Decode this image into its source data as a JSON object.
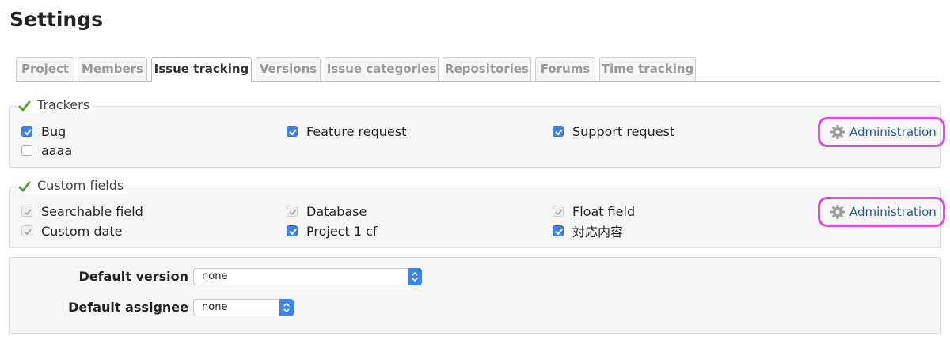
{
  "page": {
    "title": "Settings"
  },
  "tabs": [
    {
      "label": "Project",
      "active": false
    },
    {
      "label": "Members",
      "active": false
    },
    {
      "label": "Issue tracking",
      "active": true
    },
    {
      "label": "Versions",
      "active": false
    },
    {
      "label": "Issue categories",
      "active": false
    },
    {
      "label": "Repositories",
      "active": false
    },
    {
      "label": "Forums",
      "active": false
    },
    {
      "label": "Time tracking",
      "active": false
    }
  ],
  "trackers": {
    "legend": "Trackers",
    "items": [
      {
        "label": "Bug",
        "state": "checked"
      },
      {
        "label": "Feature request",
        "state": "checked"
      },
      {
        "label": "Support request",
        "state": "checked"
      },
      {
        "label": "aaaa",
        "state": "unchecked"
      }
    ],
    "admin_label": "Administration"
  },
  "custom_fields": {
    "legend": "Custom fields",
    "items": [
      {
        "label": "Searchable field",
        "state": "disabled-checked"
      },
      {
        "label": "Database",
        "state": "disabled-checked"
      },
      {
        "label": "Float field",
        "state": "disabled-checked"
      },
      {
        "label": "Custom date",
        "state": "disabled-checked"
      },
      {
        "label": "Project 1 cf",
        "state": "checked"
      },
      {
        "label": "対応内容",
        "state": "checked"
      }
    ],
    "admin_label": "Administration"
  },
  "defaults": {
    "version_label": "Default version",
    "version_value": "none",
    "assignee_label": "Default assignee",
    "assignee_value": "none"
  },
  "colors": {
    "accent": "#3b84e8",
    "highlight": "#e04ae0",
    "link": "#2a5a8a",
    "check_green": "#5a9e3a"
  }
}
